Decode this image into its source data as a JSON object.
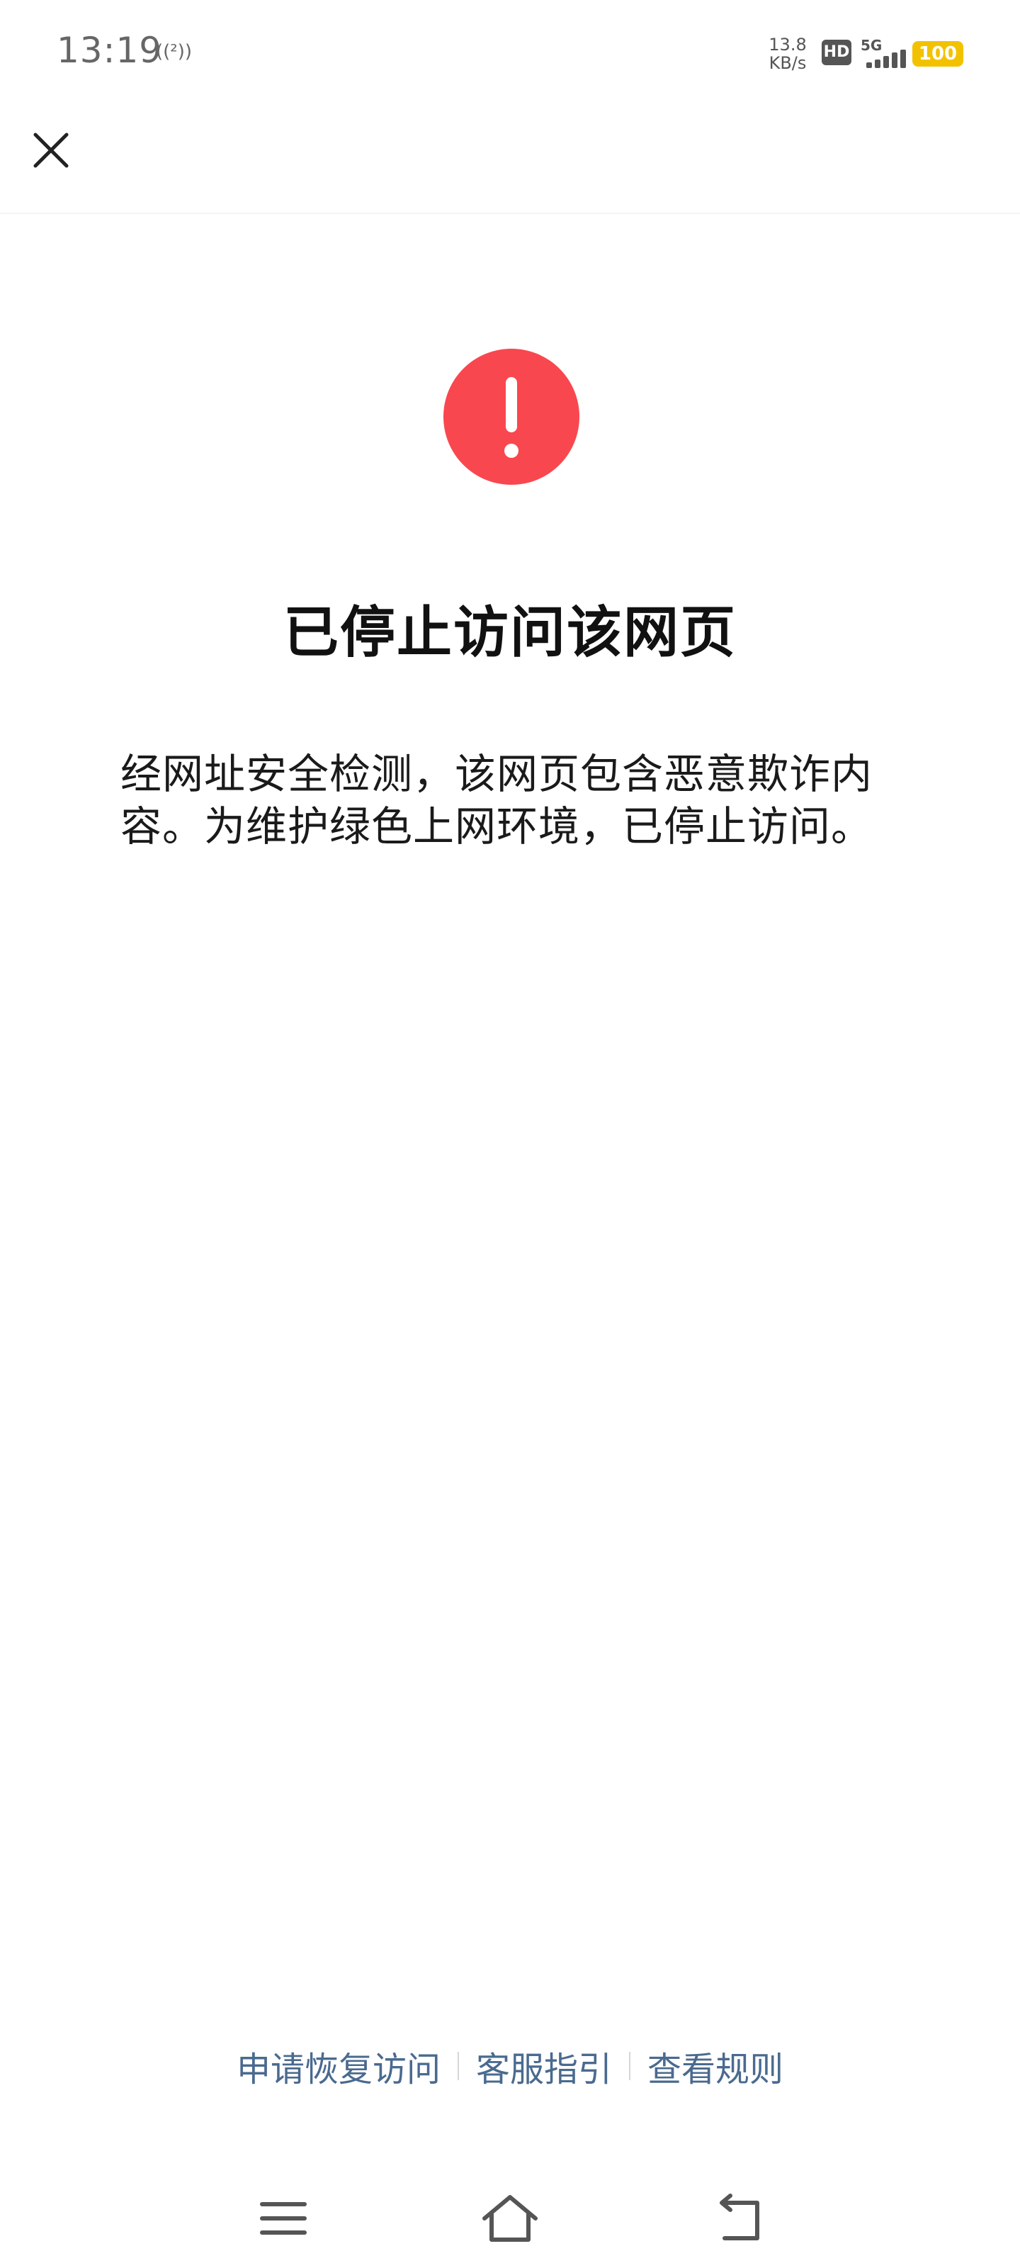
{
  "status_bar": {
    "time": "13:19",
    "hotspot": "((²))",
    "net_speed_value": "13.8",
    "net_speed_unit": "KB/s",
    "hd_badge": "HD",
    "network_type": "5G",
    "battery": "100",
    "icons": [
      "hotspot-icon",
      "hd-icon",
      "signal-icon",
      "battery-icon"
    ]
  },
  "header": {
    "close_icon": "close-icon"
  },
  "main": {
    "alert_icon": "exclamation-icon",
    "alert_color": "#f9474f",
    "title": "已停止访问该网页",
    "message": "经网址安全检测，该网页包含恶意欺诈内容。为维护绿色上网环境，已停止访问。"
  },
  "footer": {
    "links": [
      {
        "label": "申请恢复访问"
      },
      {
        "label": "客服指引"
      },
      {
        "label": "查看规则"
      }
    ],
    "link_color": "#4a6a8f"
  },
  "nav_bar": {
    "icons": [
      "menu-icon",
      "home-icon",
      "back-icon"
    ]
  }
}
